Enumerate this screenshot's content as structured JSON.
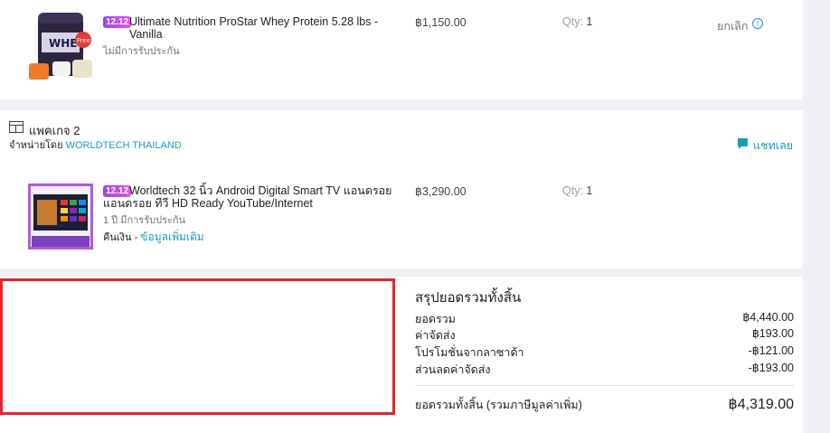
{
  "item1": {
    "badge": "12.12",
    "title": "Ultimate Nutrition ProStar Whey Protein 5.28 lbs - Vanilla",
    "warranty": "ไม่มีการรับประกัน",
    "price": "฿1,150.00",
    "qty_label": "Qty:",
    "qty_value": "1",
    "cancel_label": "ยกเลิก"
  },
  "package2": {
    "title": "แพคเกจ 2",
    "sold_by_label": "จำหน่ายโดย",
    "seller": "WORLDTECH THAILAND",
    "chat_label": "แชทเลย"
  },
  "item2": {
    "badge": "12.12",
    "title": "Worldtech 32 นิ้ว Android Digital Smart TV แอนดรอย แอนดรอย ทีวี HD Ready YouTube/Internet",
    "warranty": "1 ปี มีการรับประกัน",
    "refund_label": "คืนเงิน -",
    "more_info": "ข้อมูลเพิ่มเติม",
    "price": "฿3,290.00",
    "qty_label": "Qty:",
    "qty_value": "1"
  },
  "summary": {
    "title": "สรุปยอดรวมทั้งสิ้น",
    "rows": [
      {
        "label": "ยอดรวม",
        "value": "฿4,440.00"
      },
      {
        "label": "ค่าจัดส่ง",
        "value": "฿193.00"
      },
      {
        "label": "โปรโมชั่นจากลาซาด้า",
        "value": "-฿121.00"
      },
      {
        "label": "ส่วนลดค่าจัดส่ง",
        "value": "-฿193.00"
      }
    ],
    "total_label": "ยอดรวมทั้งสิ้น (รวมภาษีมูลค่าเพิ่ม)",
    "total_value": "฿4,319.00"
  },
  "colors": {
    "accent": "#1a9cb7",
    "highlight_border": "#e5242c",
    "background": "#eff0f5"
  }
}
